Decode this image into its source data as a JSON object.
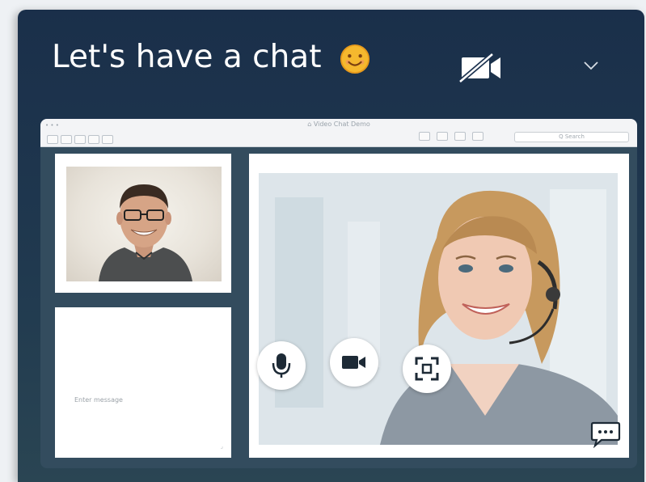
{
  "header": {
    "title": "Let's have a chat",
    "emoji_icon": "smiling-face-icon",
    "camera_icon": "camera-off-icon",
    "collapse_icon": "chevron-down-icon"
  },
  "preview": {
    "window_controls": "• • •",
    "window_title": "⌂ Video Chat Demo",
    "search_placeholder": "Q Search",
    "message_placeholder": "Enter message",
    "resize_grip": "⌟"
  },
  "controls": {
    "mic_icon": "microphone-icon",
    "video_icon": "video-camera-icon",
    "fullscreen_icon": "fullscreen-icon",
    "chat_icon": "chat-bubble-icon"
  },
  "colors": {
    "header_bg": "#1a2f4a",
    "panel_bg": "#334c5e",
    "emoji_yellow": "#f5b82e",
    "control_bg": "#ffffff",
    "icon_dark": "#1d2a36"
  }
}
